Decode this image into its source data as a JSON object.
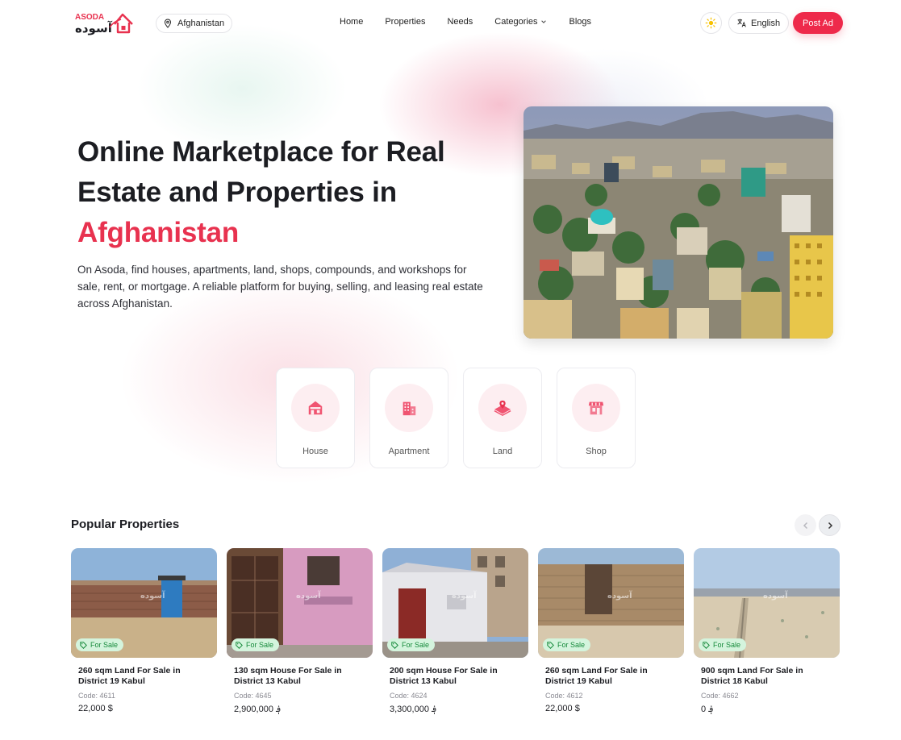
{
  "header": {
    "logo_text": "ASODA",
    "logo_text_fa": "آسوده",
    "location": "Afghanistan",
    "nav": [
      {
        "label": "Home"
      },
      {
        "label": "Properties"
      },
      {
        "label": "Needs"
      },
      {
        "label": "Categories"
      },
      {
        "label": "Blogs"
      }
    ],
    "language": "English",
    "post_ad": "Post Ad"
  },
  "hero": {
    "title_line1": "Online Marketplace for Real",
    "title_line2": "Estate and Properties in",
    "title_accent": "Afghanistan",
    "description": "On Asoda, find houses, apartments, land, shops, compounds, and workshops for sale, rent, or mortgage. A reliable platform for buying, selling, and leasing real estate across Afghanistan."
  },
  "categories": [
    {
      "label": "House",
      "icon": "house-icon"
    },
    {
      "label": "Apartment",
      "icon": "apartment-icon"
    },
    {
      "label": "Land",
      "icon": "land-icon"
    },
    {
      "label": "Shop",
      "icon": "shop-icon"
    }
  ],
  "popular": {
    "title": "Popular Properties",
    "cards": [
      {
        "badge": "For Sale",
        "title": "260 sqm Land For Sale in District 19 Kabul",
        "code": "Code: 4611",
        "price": "22,000 $"
      },
      {
        "badge": "For Sale",
        "title": "130 sqm House For Sale in District 13 Kabul",
        "code": "Code: 4645",
        "price": "2,900,000 ؋"
      },
      {
        "badge": "For Sale",
        "title": "200 sqm House For Sale in District 13 Kabul",
        "code": "Code: 4624",
        "price": "3,300,000 ؋"
      },
      {
        "badge": "For Sale",
        "title": "260 sqm Land For Sale in District 19 Kabul",
        "code": "Code: 4612",
        "price": "22,000 $"
      },
      {
        "badge": "For Sale",
        "title": "900 sqm Land For Sale in District 18 Kabul",
        "code": "Code: 4662",
        "price": "0 ؋"
      }
    ]
  },
  "colors": {
    "accent": "#ee2a4b",
    "badge_bg": "#d4f4dd",
    "badge_text": "#168a3b",
    "category_circle": "#fdeef1"
  }
}
